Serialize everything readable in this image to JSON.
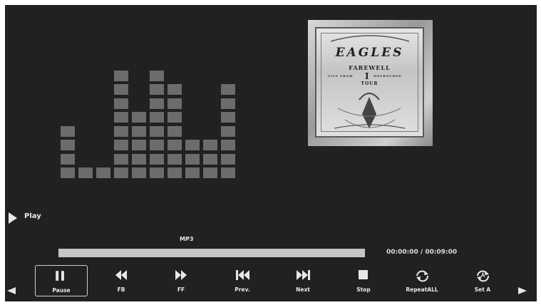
{
  "album_art": {
    "band": "EAGLES",
    "line1": "FAREWELL",
    "line2": "LIVE FROM",
    "line3": "MELBOURNE",
    "line4": "TOUR",
    "numeral": "I"
  },
  "equalizer": {
    "levels": [
      4,
      1,
      1,
      8,
      5,
      8,
      7,
      3,
      3,
      7
    ],
    "max_level": 8
  },
  "status": {
    "state_label": "Play"
  },
  "file": {
    "format": "MP3"
  },
  "progress": {
    "fraction": 1.0
  },
  "time": {
    "display": "00:00:00 / 00:09:00"
  },
  "controls": [
    {
      "id": "pause",
      "label": "Pause",
      "icon": "pause-icon",
      "selected": true
    },
    {
      "id": "fb",
      "label": "FB",
      "icon": "fast-backward-icon",
      "selected": false
    },
    {
      "id": "ff",
      "label": "FF",
      "icon": "fast-forward-icon",
      "selected": false
    },
    {
      "id": "prev",
      "label": "Prev.",
      "icon": "previous-track-icon",
      "selected": false
    },
    {
      "id": "next",
      "label": "Next",
      "icon": "next-track-icon",
      "selected": false
    },
    {
      "id": "stop",
      "label": "Stop",
      "icon": "stop-icon",
      "selected": false
    },
    {
      "id": "repeat",
      "label": "RepeatALL",
      "icon": "repeat-all-icon",
      "selected": false
    },
    {
      "id": "seta",
      "label": "Set A",
      "icon": "set-a-icon",
      "selected": false
    }
  ],
  "colors": {
    "background": "#232021",
    "eq_block": "#6c6c6c",
    "text": "#e8e8e8",
    "progress": "#c6c6c6"
  }
}
